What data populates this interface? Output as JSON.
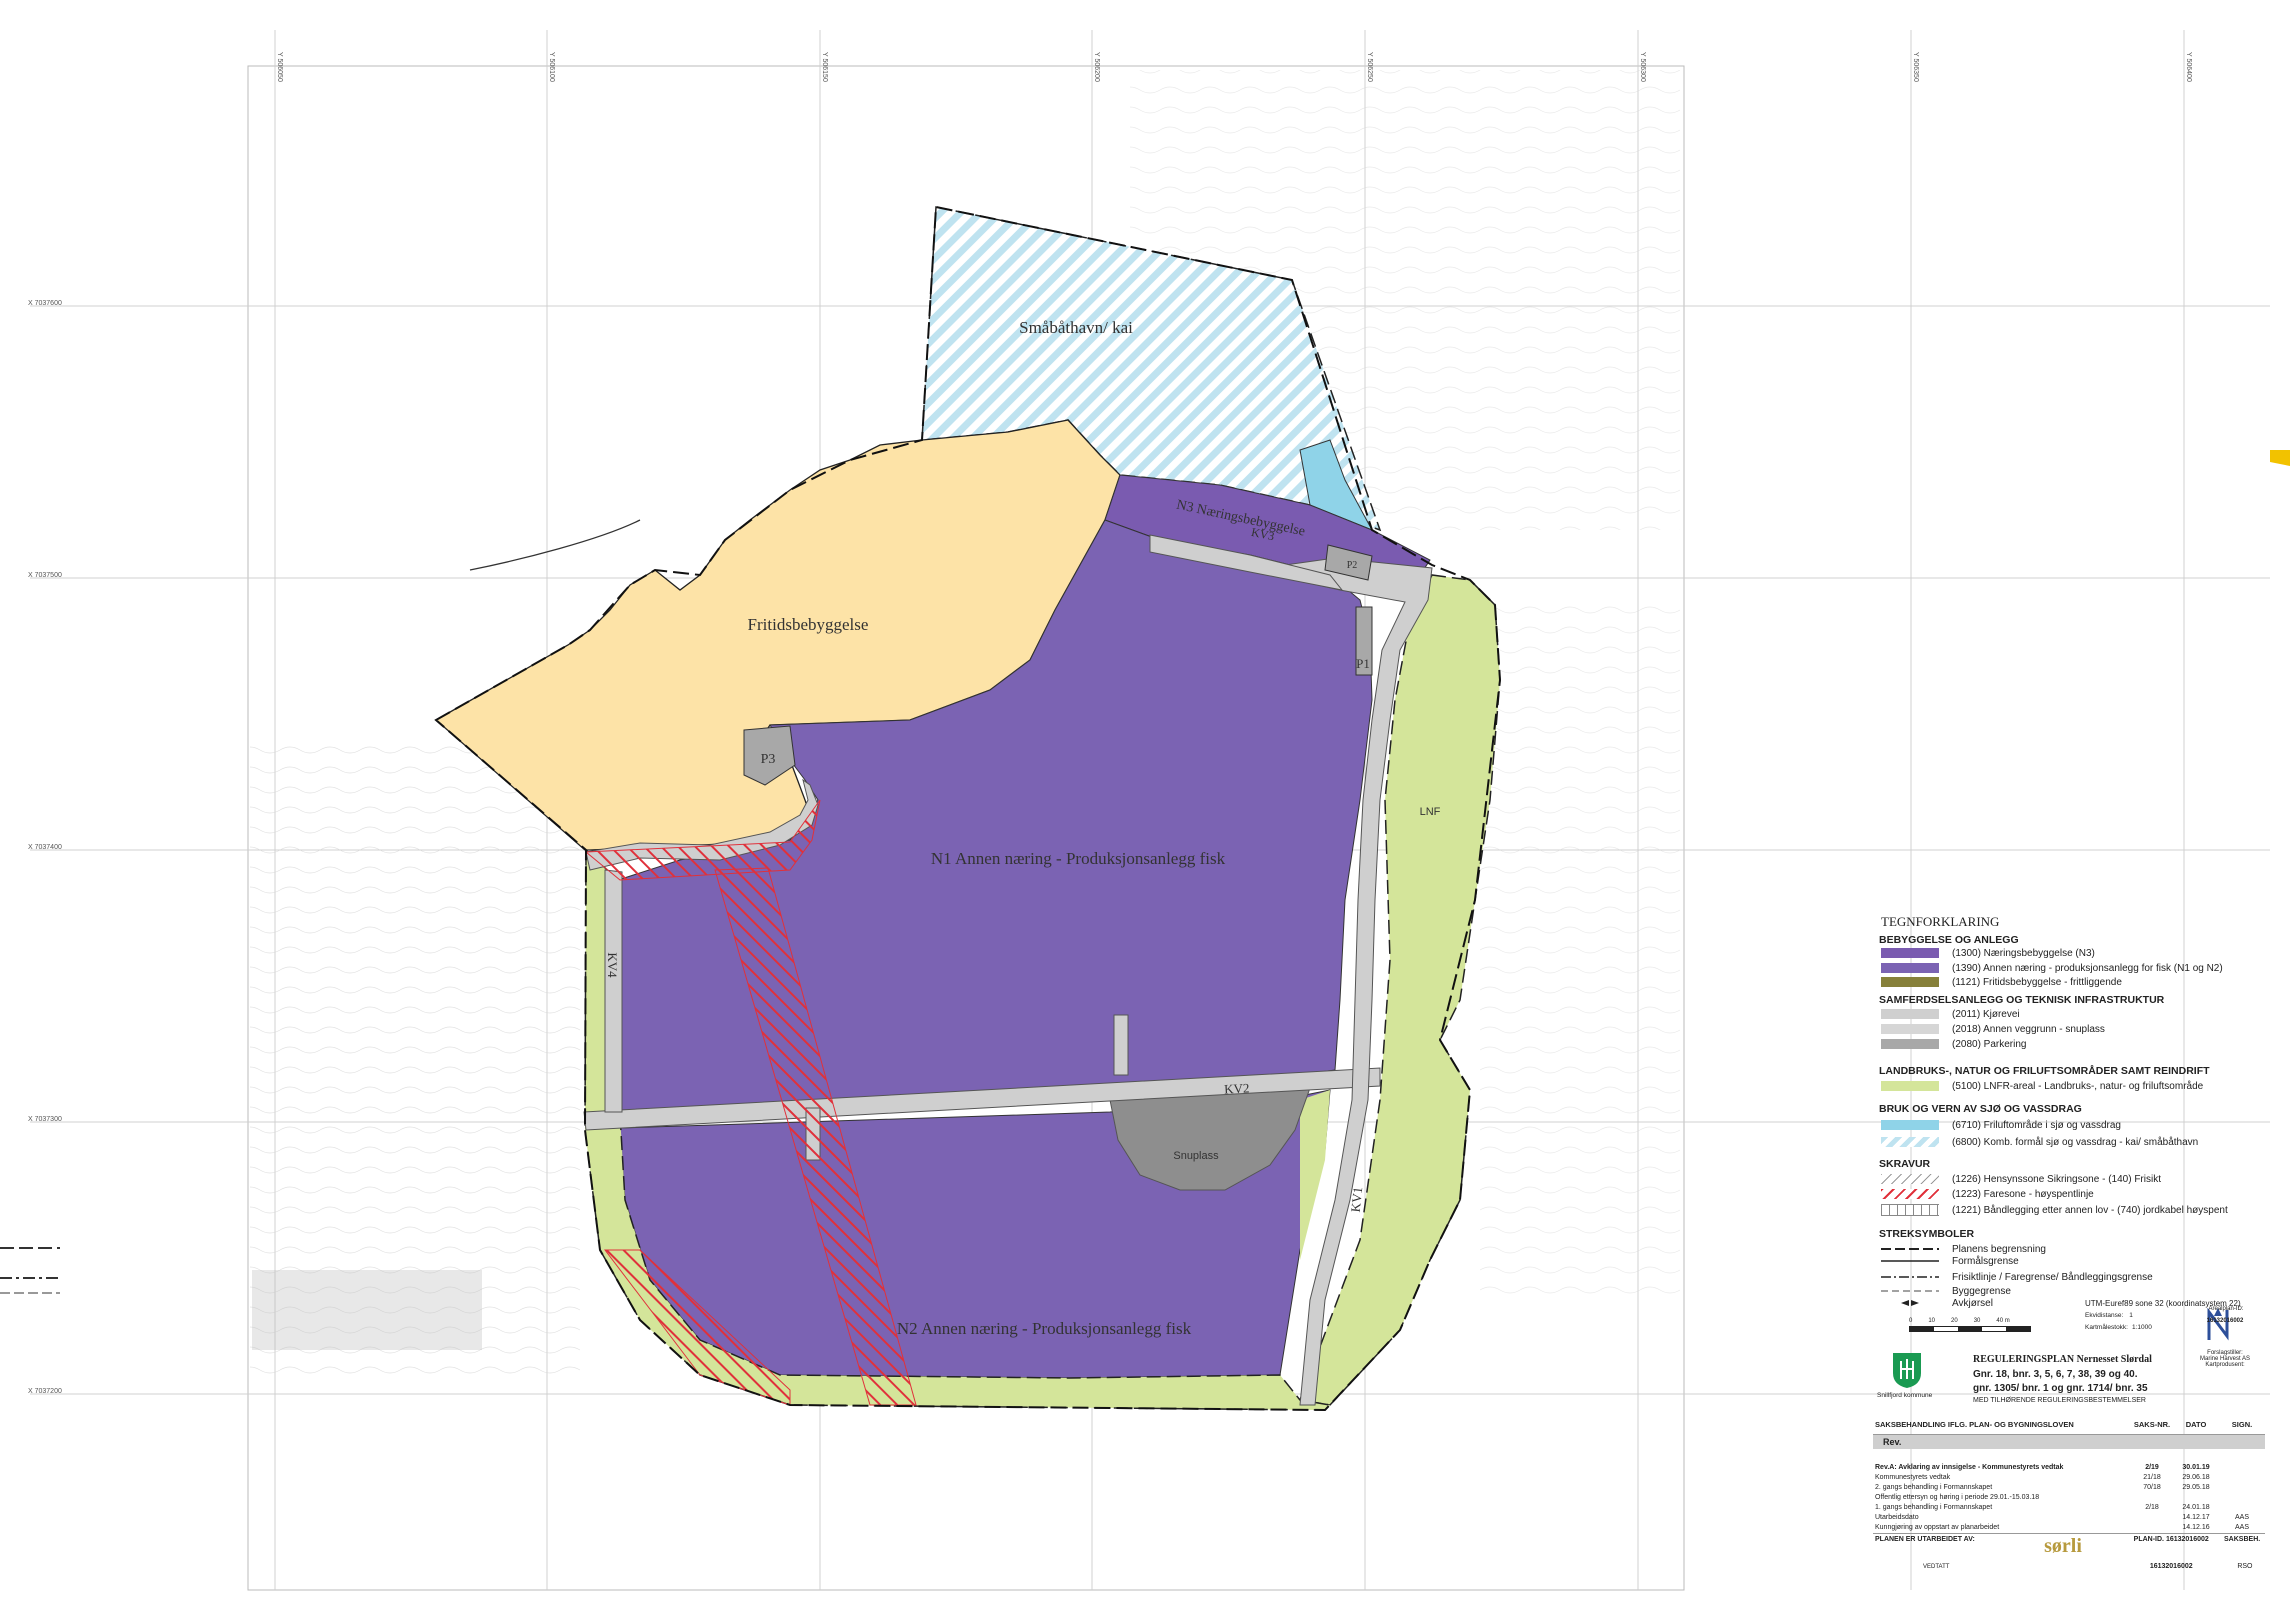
{
  "zones": {
    "smabathavn": "Småbåthavn/ kai",
    "n3": "N3 Næringsbebyggelse",
    "fritid": "Fritidsbebyggelse",
    "p1": "P1",
    "p2": "P2",
    "p3": "P3",
    "n1": "N1 Annen næring - Produksjonsanlegg fisk",
    "n2": "N2 Annen næring - Produksjonsanlegg fisk",
    "lnf": "LNF",
    "snuplass": "Snuplass",
    "kv1": "KV1",
    "kv2": "KV2",
    "kv3": "KV3",
    "kv4": "KV4"
  },
  "coords": {
    "top": [
      "Y 506050",
      "Y 506100",
      "Y 506150",
      "Y 506200",
      "Y 506250",
      "Y 506300",
      "Y 506350",
      "Y 506400"
    ],
    "left": [
      "X 7037600",
      "X 7037500",
      "X 7037400",
      "X 7037300",
      "X 7037200"
    ]
  },
  "legend": {
    "title": "TEGNFORKLARING",
    "sections": [
      {
        "title": "BEBYGGELSE OG ANLEGG",
        "items": [
          {
            "label": "(1300) Næringsbebyggelse (N3)",
            "color": "#7a5bb0"
          },
          {
            "label": "(1390) Annen næring - produksjonsanlegg for fisk (N1 og N2)",
            "color": "#7b63b3"
          },
          {
            "label": "(1121) Fritidsbebyggelse - frittliggende",
            "color": "#86803a"
          }
        ]
      },
      {
        "title": "SAMFERDSELSANLEGG OG TEKNISK INFRASTRUKTUR",
        "items": [
          {
            "label": "(2011) Kjørevei",
            "color": "#cfcfcf"
          },
          {
            "label": "(2018) Annen veggrunn - snuplass",
            "color": "#d6d6d6"
          },
          {
            "label": "(2080) Parkering",
            "color": "#a8a8a8"
          }
        ]
      },
      {
        "title": "LANDBRUKS-, NATUR OG FRILUFTSOMRÅDER SAMT REINDRIFT",
        "items": [
          {
            "label": "(5100) LNFR-areal - Landbruks-, natur- og friluftsområde",
            "color": "#d4e59a"
          }
        ]
      },
      {
        "title": "BRUK OG VERN AV SJØ OG VASSDRAG",
        "items": [
          {
            "label": "(6710) Friluftområde i sjø og vassdrag",
            "color": "#8fd3e8"
          },
          {
            "label": "(6800) Komb. formål sjø og vassdrag - kai/ småbåthavn",
            "color": "#bfe3f0"
          }
        ]
      },
      {
        "title": "SKRAVUR",
        "items": [
          {
            "label": "(1226) Hensynssone Sikringsone - (140) Frisikt",
            "color": "#ffffff"
          },
          {
            "label": "(1223) Faresone - høyspentlinje",
            "color": "#ffffff"
          },
          {
            "label": "(1221) Båndlegging etter annen lov - (740) jordkabel høyspent",
            "color": "#ffffff"
          }
        ]
      },
      {
        "title": "STREKSYMBOLER",
        "items": [
          {
            "label": "Planens begrensning"
          },
          {
            "label": "Formålsgrense"
          },
          {
            "label": "Frisiktlinje / Faregrense/ Båndleggingsgrense"
          },
          {
            "label": "Byggegrense"
          },
          {
            "label": "Avkjørsel"
          }
        ]
      }
    ],
    "utm": "UTM-Euref89 sone 32 (koordinatsystem 22)",
    "ekvidistanse_label": "Ekvidistanse:",
    "ekvidistanse": "1",
    "malestokk_label": "Kartmålestokk:",
    "malestokk": "1:1000",
    "scale_ticks": [
      "0",
      "10",
      "20",
      "30",
      "40 m"
    ],
    "arealplan_id_label": "Arealplan-ID:",
    "arealplan_id": "16132016002",
    "forslagstiller_label": "Forslagstiller:",
    "forslagstiller": "Marine Harvest AS",
    "kartprodusent_label": "Kartprodusent:",
    "municipality": "Snillfjord kommune",
    "plan_title": "REGULERINGSPLAN Nernesset Slørdal",
    "plan_line1": "Gnr. 18, bnr. 3, 5, 6, 7, 38, 39 og 40.",
    "plan_line2": "gnr. 1305/ bnr. 1 og gnr. 1714/ bnr. 35",
    "plan_line3": "MED TILHØRENDE REGULERINGSBESTEMMELSER"
  },
  "table": {
    "headers": [
      "SAKSBEHANDLING IFLG. PLAN- OG BYGNINGSLOVEN",
      "SAKS-NR.",
      "DATO",
      "SIGN."
    ],
    "rev_label": "Rev.",
    "rows": [
      {
        "text": "Rev.A: Avklaring av innsigelse - Kommunestyrets vedtak",
        "nr": "2/19",
        "dato": "30.01.19",
        "sign": ""
      },
      {
        "text": "Kommunestyrets vedtak",
        "nr": "21/18",
        "dato": "29.06.18",
        "sign": ""
      },
      {
        "text": "2. gangs behandling i Formannskapet",
        "nr": "70/18",
        "dato": "29.05.18",
        "sign": ""
      },
      {
        "text": "Offentlig ettersyn og høring i periode 29.01.-15.03.18",
        "nr": "",
        "dato": "",
        "sign": ""
      },
      {
        "text": "1. gangs behandling i Formannskapet",
        "nr": "2/18",
        "dato": "24.01.18",
        "sign": ""
      },
      {
        "text": "Utarbeidsdato",
        "nr": "",
        "dato": "14.12.17",
        "sign": "AAS"
      },
      {
        "text": "Kunngjøring av oppstart av planarbeidet",
        "nr": "",
        "dato": "14.12.16",
        "sign": "AAS"
      }
    ],
    "prepared_label": "PLANEN ER UTARBEIDET AV:",
    "company": "sørli",
    "plan_id_label": "PLAN-ID. 16132016002",
    "plan_id": "16132016002",
    "saksbeh_label": "SAKSBEH.",
    "saksbeh": "RSO",
    "vedtatt_label": "VEDTATT"
  },
  "colors": {
    "purple": "#7b63b3",
    "yellow": "#fde3a7",
    "lnf_green": "#d4e59a",
    "sea_blue": "#8fd3e8",
    "road": "#cfcfcf",
    "parking": "#a8a8a8",
    "hazard_red": "#e0313b"
  }
}
